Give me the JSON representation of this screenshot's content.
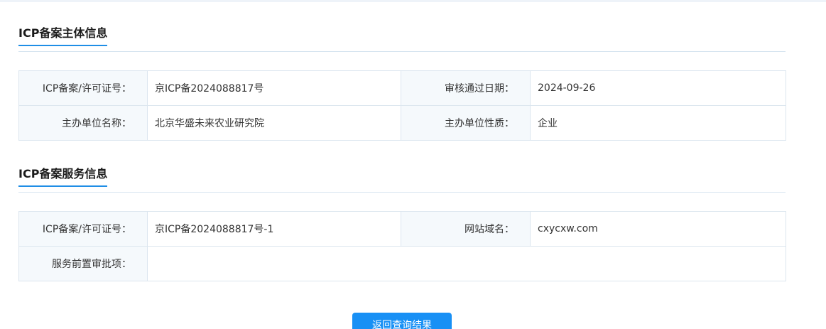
{
  "subject_section": {
    "title": "ICP备案主体信息",
    "rows": [
      {
        "label1": "ICP备案/许可证号：",
        "value1": "京ICP备2024088817号",
        "label2": "审核通过日期：",
        "value2": "2024-09-26"
      },
      {
        "label1": "主办单位名称：",
        "value1": "北京华盛未来农业研究院",
        "label2": "主办单位性质：",
        "value2": "企业"
      }
    ]
  },
  "service_section": {
    "title": "ICP备案服务信息",
    "rows": [
      {
        "label1": "ICP备案/许可证号：",
        "value1": "京ICP备2024088817号-1",
        "label2": "网站域名：",
        "value2": "cxycxw.com"
      },
      {
        "label1": "服务前置审批项：",
        "value1": ""
      }
    ]
  },
  "actions": {
    "back_label": "返回查询结果"
  },
  "colors": {
    "accent": "#1f8ee6",
    "button": "#1890f5",
    "label_bg": "#f5f9fc",
    "border": "#dce6ef"
  }
}
